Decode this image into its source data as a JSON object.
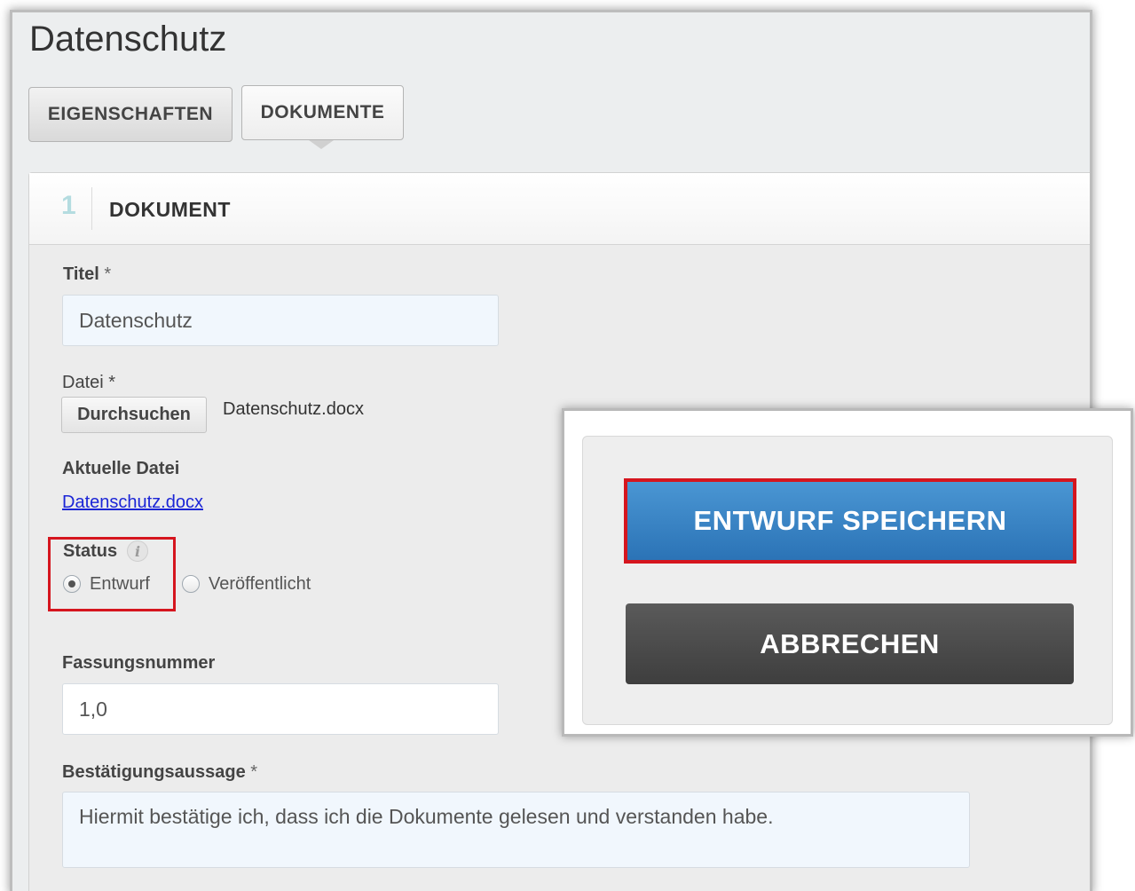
{
  "page": {
    "title": "Datenschutz"
  },
  "tabs": [
    {
      "label": "EIGENSCHAFTEN",
      "active": false
    },
    {
      "label": "DOKUMENTE",
      "active": true
    }
  ],
  "section": {
    "number": "1",
    "title": "DOKUMENT"
  },
  "form": {
    "title": {
      "label": "Titel",
      "required_mark": "*",
      "value": "Datenschutz"
    },
    "file": {
      "label": "Datei",
      "required_mark": "*",
      "browse_label": "Durchsuchen",
      "selected_file": "Datenschutz.docx"
    },
    "current_file": {
      "label": "Aktuelle Datei",
      "link": "Datenschutz.docx"
    },
    "status": {
      "label": "Status",
      "info_icon": "info-icon",
      "options": [
        {
          "label": "Entwurf",
          "checked": true
        },
        {
          "label": "Veröffentlicht",
          "checked": false
        }
      ]
    },
    "version": {
      "label": "Fassungsnummer",
      "value": "1,0"
    },
    "confirmation": {
      "label": "Bestätigungsaussage",
      "required_mark": "*",
      "value": "Hiermit bestätige ich, dass ich die Dokumente gelesen und verstanden habe."
    }
  },
  "actions": {
    "save_draft_label": "ENTWURF SPEICHERN",
    "cancel_label": "ABBRECHEN"
  },
  "colors": {
    "highlight": "#d5151e",
    "primary_button": "#2f7bbf",
    "cancel_button": "#474747",
    "link": "#1b25d6"
  }
}
